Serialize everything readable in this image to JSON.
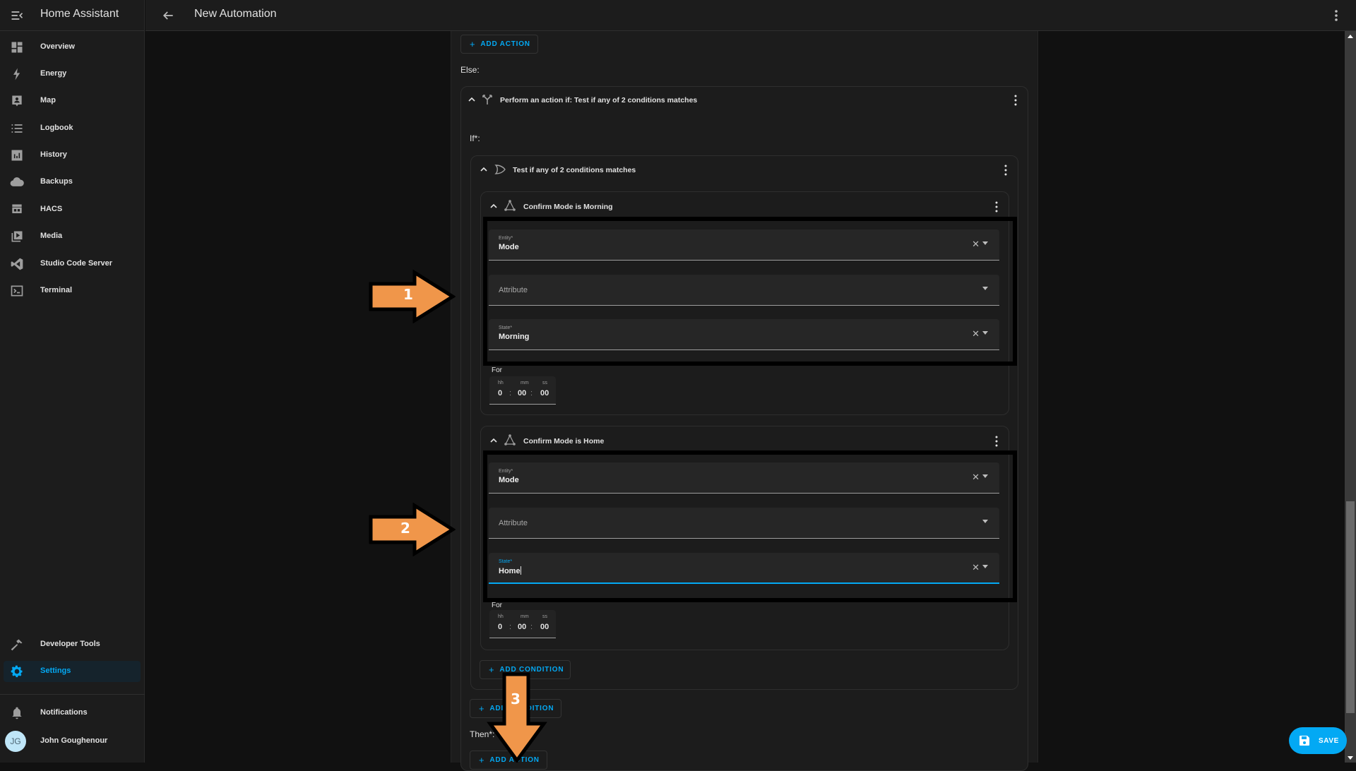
{
  "app": {
    "title": "Home Assistant",
    "page_title": "New Automation"
  },
  "sidebar": {
    "items": [
      {
        "label": "Overview",
        "icon": "dashboard-icon"
      },
      {
        "label": "Energy",
        "icon": "lightning-icon"
      },
      {
        "label": "Map",
        "icon": "map-person-icon"
      },
      {
        "label": "Logbook",
        "icon": "list-icon"
      },
      {
        "label": "History",
        "icon": "chart-icon"
      },
      {
        "label": "Backups",
        "icon": "cloud-icon"
      },
      {
        "label": "HACS",
        "icon": "hacs-store-icon"
      },
      {
        "label": "Media",
        "icon": "media-play-icon"
      },
      {
        "label": "Studio Code Server",
        "icon": "vscode-icon"
      },
      {
        "label": "Terminal",
        "icon": "terminal-icon"
      }
    ],
    "bottom_items": [
      {
        "label": "Developer Tools",
        "icon": "hammer-icon"
      },
      {
        "label": "Settings",
        "icon": "gear-icon",
        "active": true
      }
    ],
    "notifications_label": "Notifications",
    "user": {
      "name": "John Goughenour",
      "initials": "JG"
    }
  },
  "editor": {
    "top_add_action": "ADD ACTION",
    "else_label": "Else:",
    "if_then_card": {
      "title": "Perform an action if: Test if any of 2 conditions matches",
      "if_label": "If*:",
      "or_card": {
        "title": "Test if any of 2 conditions matches",
        "conditions": [
          {
            "title": "Confirm Mode is Morning",
            "entity_label": "Entity*",
            "entity_value": "Mode",
            "attribute_placeholder": "Attribute",
            "state_label": "State*",
            "state_value": "Morning",
            "for_label": "For",
            "duration": {
              "hh_label": "hh",
              "mm_label": "mm",
              "ss_label": "ss",
              "hh": "0",
              "mm": "00",
              "ss": "00"
            }
          },
          {
            "title": "Confirm Mode is Home",
            "entity_label": "Entity*",
            "entity_value": "Mode",
            "attribute_placeholder": "Attribute",
            "state_label": "State*",
            "state_value": "Home",
            "state_focused": true,
            "for_label": "For",
            "duration": {
              "hh_label": "hh",
              "mm_label": "mm",
              "ss_label": "ss",
              "hh": "0",
              "mm": "00",
              "ss": "00"
            }
          }
        ],
        "add_condition_label": "ADD CONDITION"
      },
      "add_condition_label": "ADD CONDITION",
      "then_label": "Then*:",
      "add_action_label": "ADD ACTION"
    }
  },
  "save_button": {
    "label": "SAVE"
  },
  "annotations": [
    {
      "number": "1",
      "direction": "right",
      "color": "#f0964a"
    },
    {
      "number": "2",
      "direction": "right",
      "color": "#f0964a"
    },
    {
      "number": "3",
      "direction": "down",
      "color": "#f0964a"
    }
  ],
  "colors": {
    "accent": "#03a9f4",
    "annotation": "#f0964a"
  }
}
